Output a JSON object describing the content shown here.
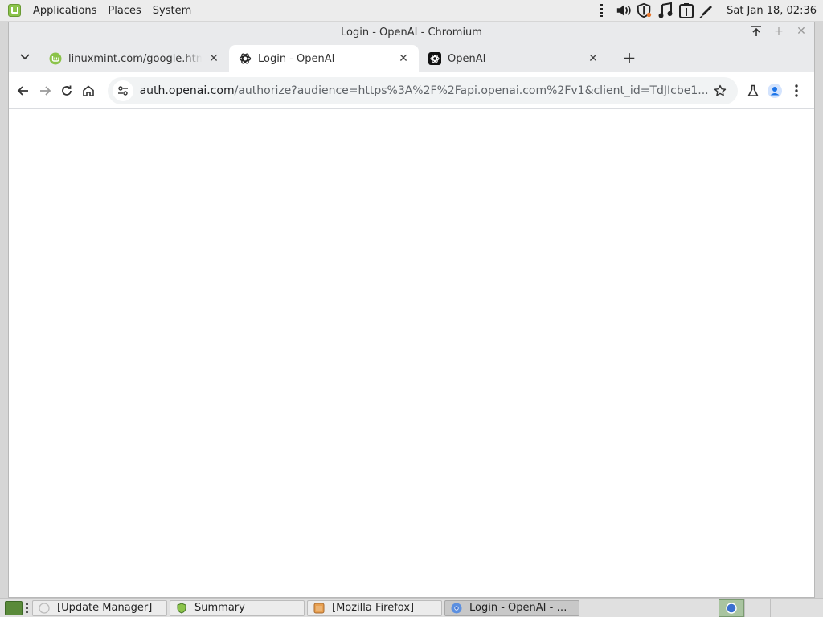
{
  "top_panel": {
    "menu": [
      "Applications",
      "Places",
      "System"
    ],
    "clock": "Sat Jan 18, 02:36"
  },
  "window": {
    "title": "Login - OpenAI - Chromium"
  },
  "tabs": [
    {
      "title": "linuxmint.com/google.html",
      "favicon": "linuxmint-icon"
    },
    {
      "title": "Login - OpenAI",
      "favicon": "openai-icon",
      "active": true
    },
    {
      "title": "OpenAI",
      "favicon": "openai-icon"
    }
  ],
  "toolbar": {
    "url_host": "auth.openai.com",
    "url_path": "/authorize?audience=https%3A%2F%2Fapi.openai.com%2Fv1&client_id=TdJIcbe1..."
  },
  "taskbar": [
    {
      "label": "[Update Manager]",
      "icon": "update-manager-icon"
    },
    {
      "label": "Summary",
      "icon": "shield-icon"
    },
    {
      "label": "[Mozilla Firefox]",
      "icon": "firefox-icon"
    },
    {
      "label": "Login - OpenAI - Chr…",
      "icon": "chromium-icon",
      "active": true
    }
  ],
  "colors": {
    "accent": "#1a73e8",
    "mint_green": "#8bc34a"
  }
}
